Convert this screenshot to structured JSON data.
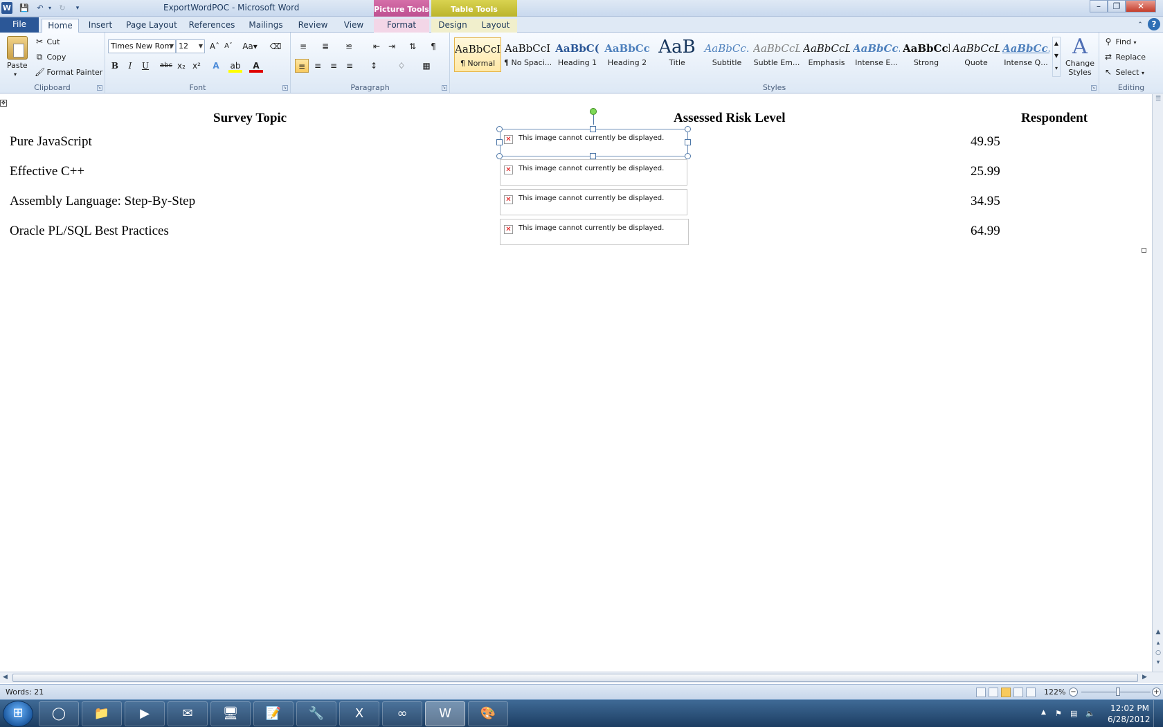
{
  "window": {
    "title": "ExportWordPOC - Microsoft Word",
    "logo": "W",
    "context_picture": "Picture Tools",
    "context_table": "Table Tools"
  },
  "tabs": {
    "file": "File",
    "home": "Home",
    "insert": "Insert",
    "page_layout": "Page Layout",
    "references": "References",
    "mailings": "Mailings",
    "review": "Review",
    "view": "View",
    "format": "Format",
    "design": "Design",
    "layout": "Layout"
  },
  "clipboard": {
    "paste": "Paste",
    "cut": "Cut",
    "copy": "Copy",
    "format_painter": "Format Painter",
    "label": "Clipboard"
  },
  "font": {
    "name": "Times New Rom",
    "size": "12",
    "label": "Font"
  },
  "paragraph": {
    "label": "Paragraph"
  },
  "styles": {
    "label": "Styles",
    "items": [
      {
        "sample": "AaBbCcI",
        "name": "¶ Normal"
      },
      {
        "sample": "AaBbCcI",
        "name": "¶ No Spaci..."
      },
      {
        "sample": "AaBbC(",
        "name": "Heading 1"
      },
      {
        "sample": "AaBbCc",
        "name": "Heading 2"
      },
      {
        "sample": "AaB",
        "name": "Title"
      },
      {
        "sample": "AaBbCc.",
        "name": "Subtitle"
      },
      {
        "sample": "AaBbCcL",
        "name": "Subtle Em..."
      },
      {
        "sample": "AaBbCcL",
        "name": "Emphasis"
      },
      {
        "sample": "AaBbCc.",
        "name": "Intense E..."
      },
      {
        "sample": "AaBbCcl",
        "name": "Strong"
      },
      {
        "sample": "AaBbCcL",
        "name": "Quote"
      },
      {
        "sample": "AaBbCc.",
        "name": "Intense Q..."
      }
    ],
    "change_styles": "Change Styles"
  },
  "editing": {
    "label": "Editing",
    "find": "Find",
    "replace": "Replace",
    "select": "Select"
  },
  "document": {
    "headers": [
      "Survey Topic",
      "Assessed Risk Level",
      "Respondent"
    ],
    "rows": [
      {
        "topic": "Pure JavaScript",
        "value": "49.95"
      },
      {
        "topic": "Effective C++",
        "value": "25.99"
      },
      {
        "topic": "Assembly Language: Step-By-Step",
        "value": "34.95"
      },
      {
        "topic": "Oracle PL/SQL Best Practices",
        "value": "64.99"
      }
    ],
    "image_placeholder": "This image cannot currently be displayed."
  },
  "status": {
    "words": "Words: 21",
    "zoom": "122%",
    "zoom_level_percent": 122
  },
  "taskbar": {
    "time": "12:02 PM",
    "date": "6/28/2012"
  },
  "colors": {
    "file_tab": "#2b5797",
    "picture_tools": "#b8488a",
    "table_tools": "#b3ac23",
    "taskbar": "#1c3d62"
  }
}
